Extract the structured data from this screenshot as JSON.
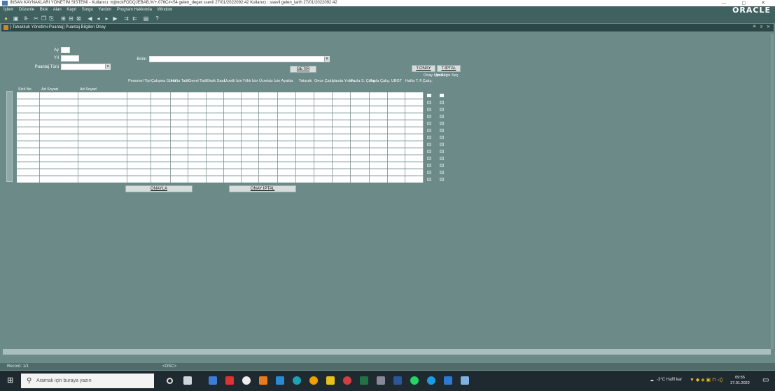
{
  "window": {
    "title": "İNSAN KAYNAKLARI YÖNETİM SİSTEMİ - Kullanıcı: mj|mckFODQJEBAB,%'+.076C#<54 gelen_deger:ssevil       27/01/2022092:42 Kullanıcı : ssevil gelen_tarih 27/01/2022092:42",
    "controls": "— ◻ ✕"
  },
  "menu": [
    "İşlem",
    "Düzenle",
    "Blok",
    "Alan",
    "Kayıt",
    "Sorgu",
    "Yardım",
    "Program Hakkında",
    "Window"
  ],
  "brand": "ORACLE",
  "toolbar_icons": [
    "open-icon",
    "print-icon",
    "close-form-icon",
    "cut-icon",
    "copy-icon",
    "paste-icon",
    "enter-query-icon",
    "execute-query-icon",
    "cancel-query-icon",
    "first-record-icon",
    "prev-record-icon",
    "next-record-icon",
    "last-record-icon",
    "insert-record-icon",
    "delete-record-icon",
    "list-icon",
    "help-icon"
  ],
  "form": {
    "title": "[-Tahakkuk Yönetimi-Puantaj] Puantaj Bilgileri Onay",
    "controls": "≝ ≡ ✕",
    "labels": {
      "ay": "Ay",
      "yil": "Yıl",
      "puantaj_turu": "Puantaj Türü",
      "birim": "Birim"
    },
    "buttons": {
      "getir": "GETİR",
      "t_onay": "T.ONAY",
      "t_iptal": "T.İPTAL",
      "onayla": "ONAYLA",
      "onay_iptal": "ONAY İPTAL"
    },
    "columns": [
      "Sicil No",
      "Ad Soyad",
      "Ad Soyad",
      "Personel Tipi",
      "Çalışma Günü",
      "Hafta Tatili",
      "Genel Tatil",
      "Eksik Saat",
      "Ücretli İzin",
      "Yıllık İzin",
      "Ücretsiz İzin",
      "Ayakta",
      "Yatarak",
      "Gece Çalış.",
      "Vasıta Yrdm.",
      "Fazla S. Çalış.",
      "Fazla Çalış.",
      "UBGT",
      "Hafta T. F.Çalış.",
      "Onay İçin Seç",
      "İptal İçin Seç"
    ],
    "row_count": 13
  },
  "status": {
    "record": "Record: 1/1",
    "osc": "<OSC>"
  },
  "taskbar": {
    "search_placeholder": "Aramak için buraya yazın",
    "weather": "-3°C  Hafif kar",
    "time": "09:55",
    "date": "27.01.2022"
  }
}
